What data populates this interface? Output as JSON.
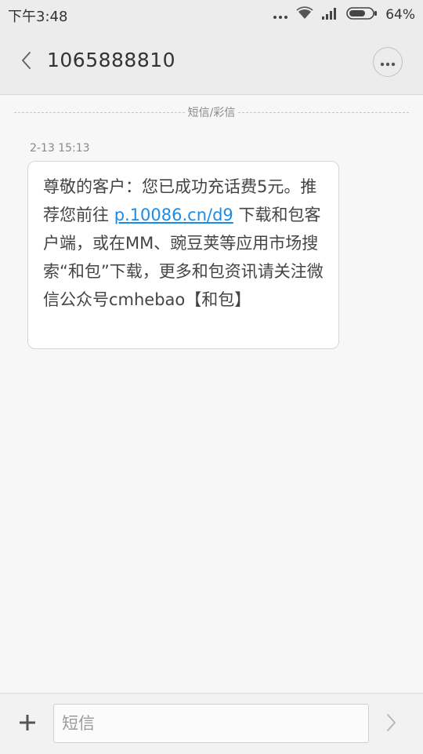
{
  "status_bar": {
    "time": "下午3:48",
    "battery_text": "64%",
    "icons": [
      "more-dots-icon",
      "wifi-icon",
      "signal-icon",
      "battery-icon"
    ]
  },
  "header": {
    "contact": "1065888810",
    "back_icon": "chevron-left-icon",
    "more_icon": "more-dots-icon"
  },
  "thread": {
    "divider_label": "短信/彩信",
    "message": {
      "time": "2-13 15:13",
      "text_part1": "尊敬的客户：您已成功充话费5元。推荐您前往 ",
      "link": "p.10086.cn/d9",
      "text_part2": " 下载和包客户端，或在MM、豌豆荚等应用市场搜索“和包”下载，更多和包资讯请关注微信公众号cmhebao【和包】"
    }
  },
  "input_bar": {
    "placeholder": "短信",
    "value": "",
    "attach_icon": "plus-icon",
    "send_icon": "chevron-right-icon"
  },
  "colors": {
    "link": "#1a8ce8",
    "background": "#f7f7f7",
    "header": "#ececec"
  }
}
